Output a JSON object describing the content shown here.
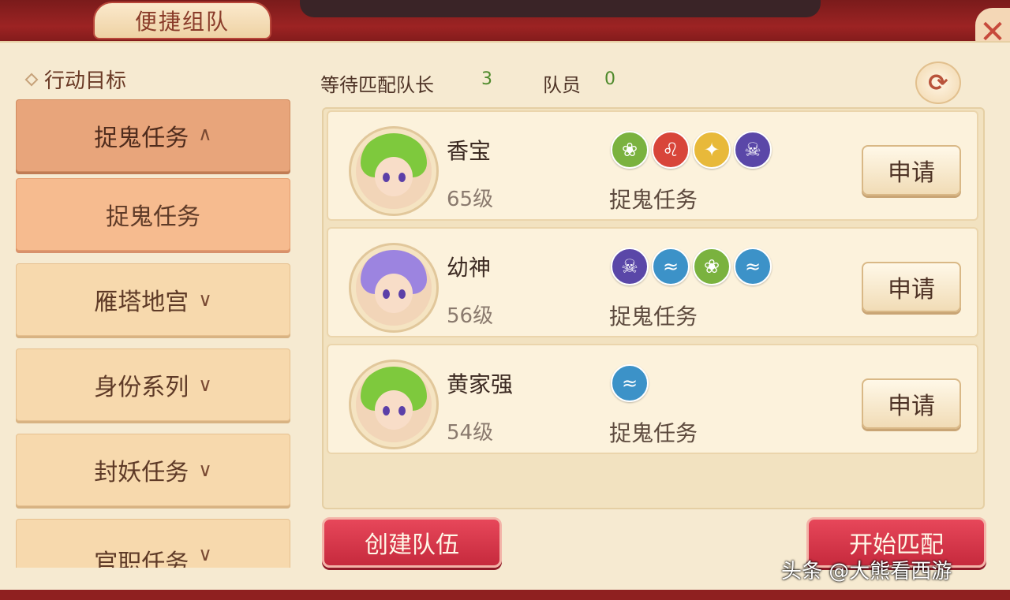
{
  "header": {
    "title": "便捷组队"
  },
  "sidebar": {
    "title": "行动目标",
    "items": [
      {
        "label": "捉鬼任务",
        "state": "open"
      },
      {
        "label": "捉鬼任务",
        "state": "active"
      },
      {
        "label": "雁塔地宫",
        "state": "collapsed"
      },
      {
        "label": "身份系列",
        "state": "collapsed"
      },
      {
        "label": "封妖任务",
        "state": "collapsed"
      },
      {
        "label": "官职任务",
        "state": "collapsed"
      }
    ]
  },
  "stats": {
    "leader_label": "等待匹配队长",
    "leader_count": "3",
    "member_label": "队员",
    "member_count": "0"
  },
  "teams": [
    {
      "name": "香宝",
      "level": "65级",
      "task": "捉鬼任务",
      "badges": [
        "lotus-icon",
        "lion-icon",
        "sword-icon",
        "skull-icon"
      ]
    },
    {
      "name": "幼神",
      "level": "56级",
      "task": "捉鬼任务",
      "badges": [
        "skull-icon",
        "dragon-icon",
        "lotus-icon",
        "dragon-icon"
      ]
    },
    {
      "name": "黄家强",
      "level": "54级",
      "task": "捉鬼任务",
      "badges": [
        "dragon-icon"
      ]
    }
  ],
  "apply_label": "申请",
  "buttons": {
    "create": "创建队伍",
    "start": "开始匹配"
  },
  "watermark": "头条 @大熊看西游",
  "colors": {
    "lotus": "#7ab23f",
    "lion": "#d8453a",
    "sword": "#e8b93a",
    "skull": "#5a47a8",
    "dragon": "#3c92c8"
  }
}
